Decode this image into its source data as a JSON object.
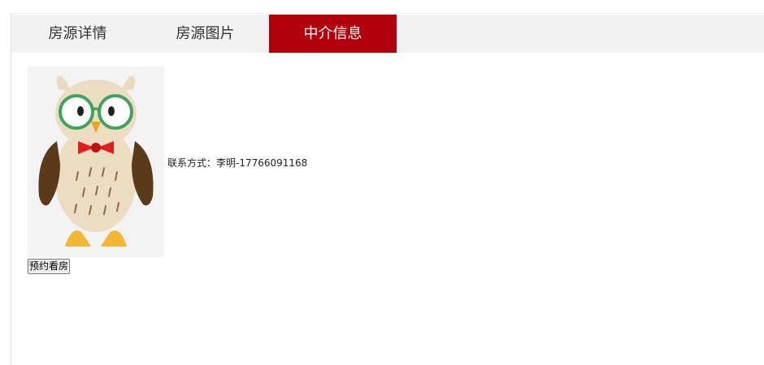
{
  "tabs": [
    {
      "label": "房源详情",
      "active": false
    },
    {
      "label": "房源图片",
      "active": false
    },
    {
      "label": "中介信息",
      "active": true
    }
  ],
  "agent": {
    "avatar_icon": "owl-avatar-icon",
    "contact_text": "联系方式：李明-17766091168"
  },
  "actions": {
    "book_viewing_label": "预约看房"
  },
  "colors": {
    "active_tab": "#b1000b",
    "tabbar_bg": "#f2f2f2"
  }
}
